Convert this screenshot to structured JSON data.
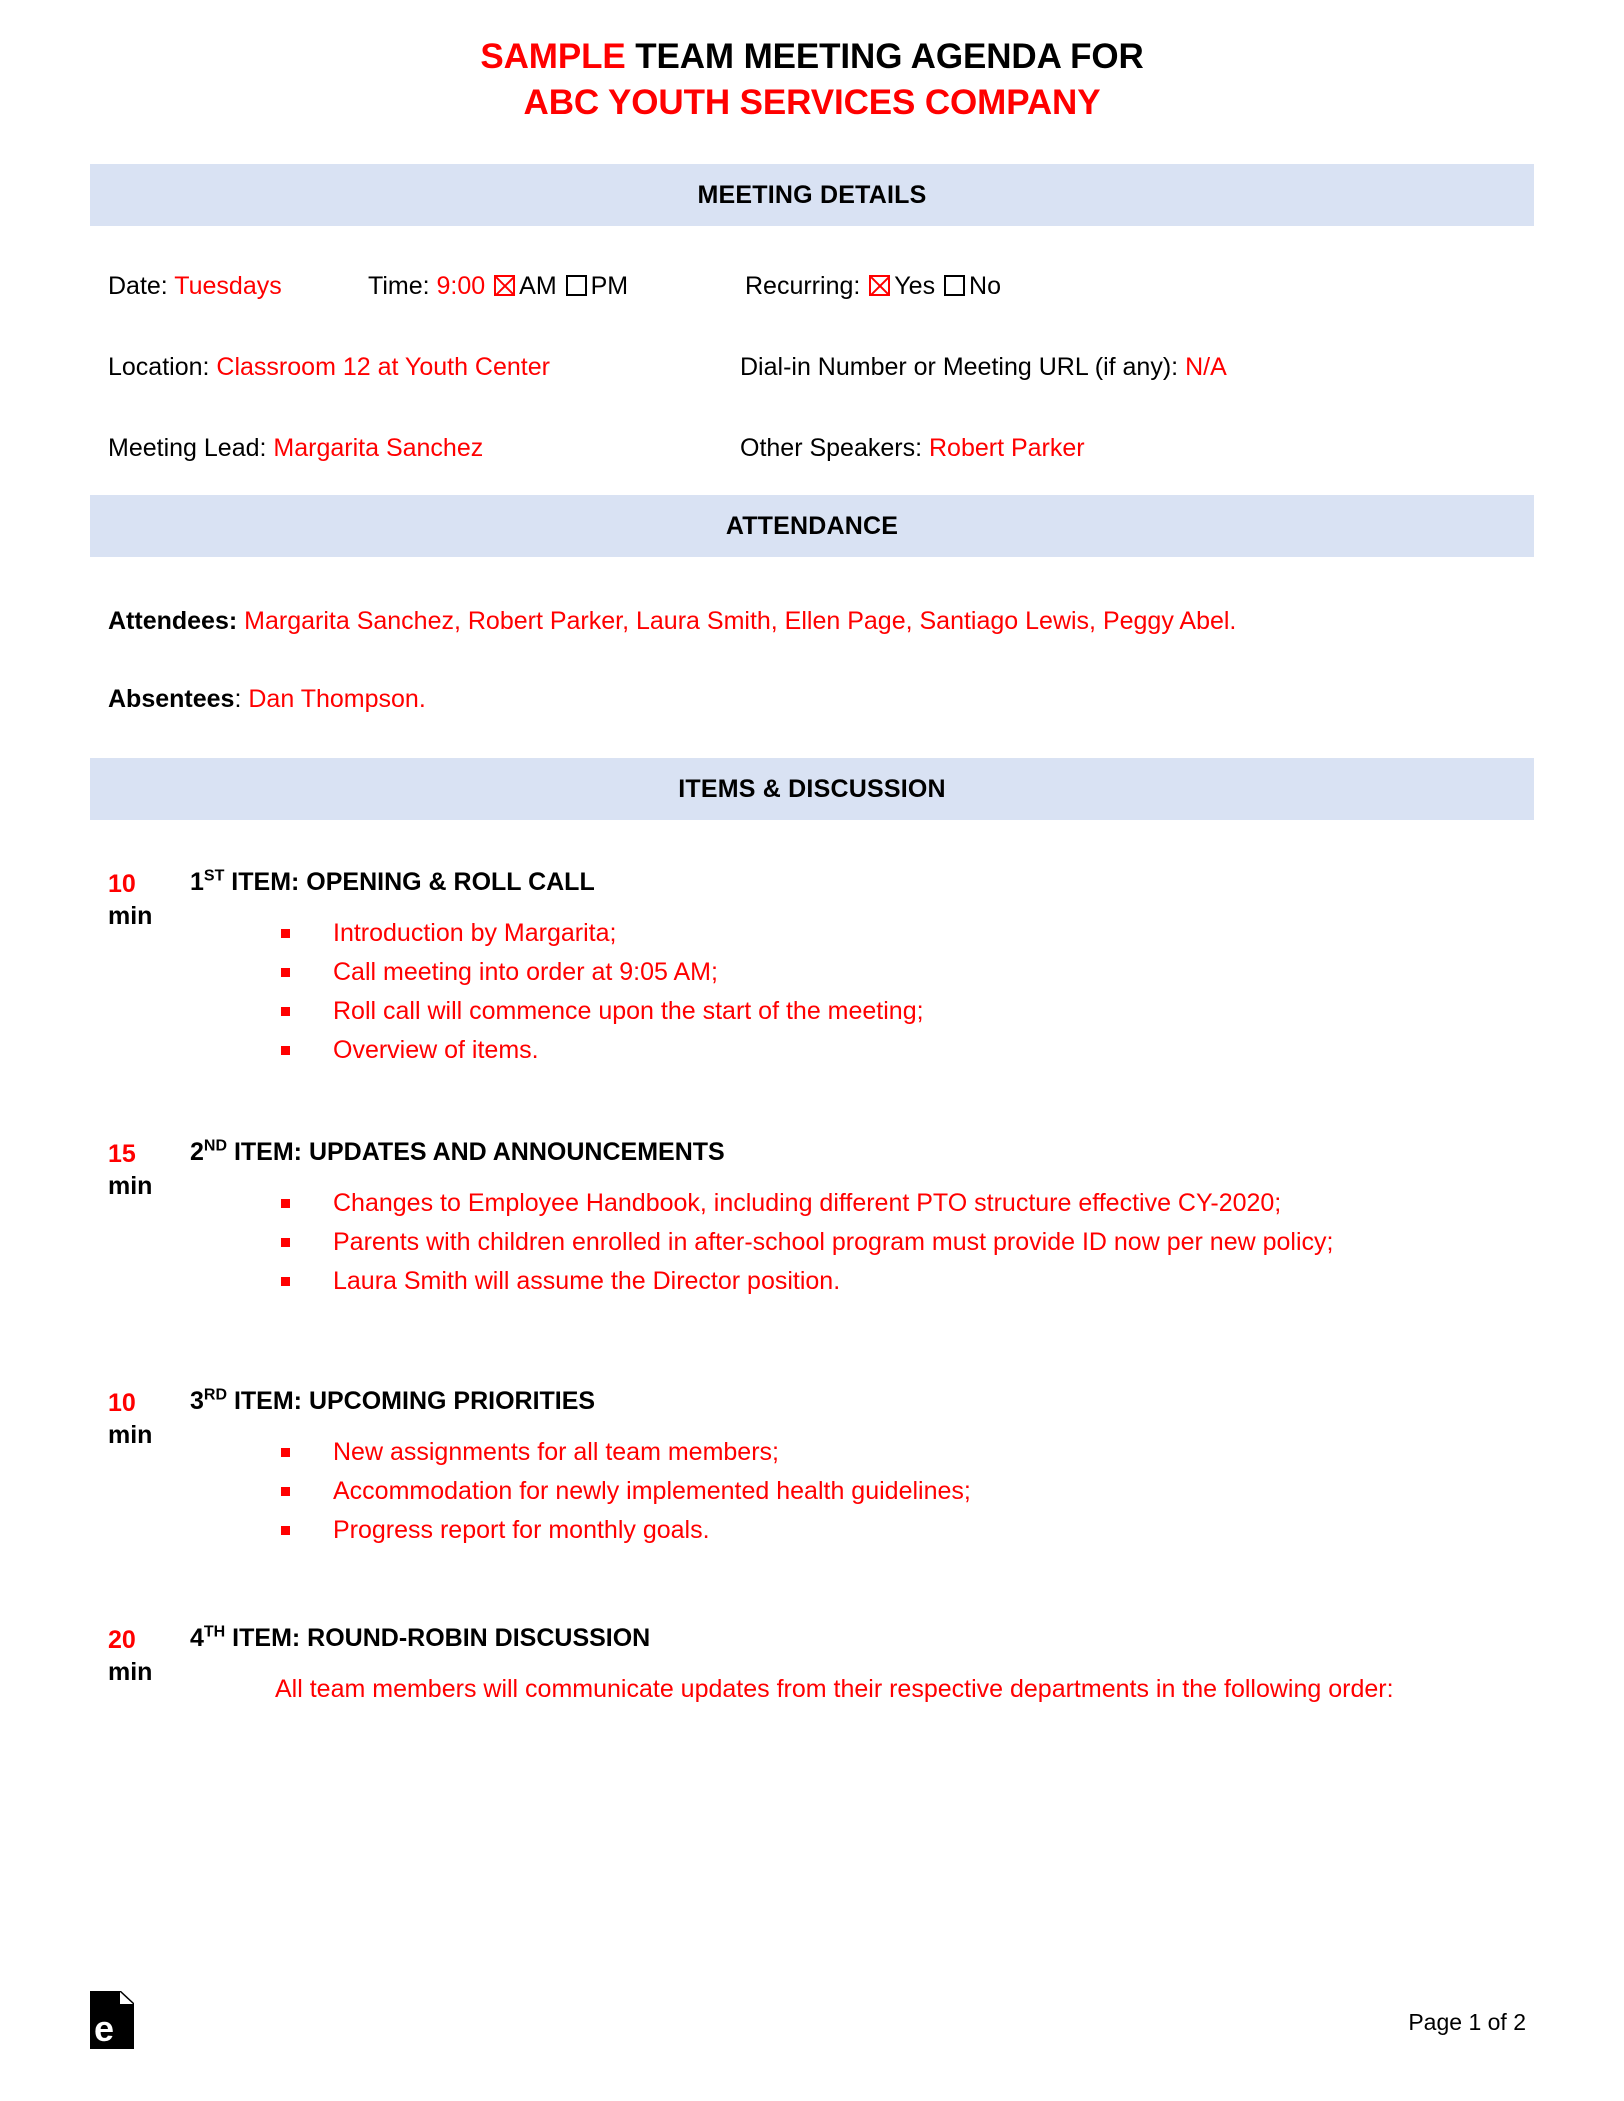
{
  "document": {
    "title_line1_highlight": "SAMPLE",
    "title_line1_rest": " TEAM MEETING AGENDA FOR",
    "title_line2": "ABC YOUTH SERVICES COMPANY",
    "accent_color": "#ff0000",
    "band_color": "#d9e2f3"
  },
  "sections": {
    "meeting_details_heading": "MEETING DETAILS",
    "attendance_heading": "ATTENDANCE",
    "items_heading": "ITEMS & DISCUSSION"
  },
  "meeting_details": {
    "date_label": "Date:",
    "date_value": "Tuesdays",
    "time_label": "Time:",
    "time_value": "9:00",
    "am_label": "AM",
    "pm_label": "PM",
    "am_checked": true,
    "pm_checked": false,
    "recurring_label": "Recurring:",
    "recurring_yes_label": "Yes",
    "recurring_no_label": "No",
    "recurring_yes_checked": true,
    "recurring_no_checked": false,
    "location_label": "Location:",
    "location_value": "Classroom 12 at Youth Center",
    "dialin_label": "Dial-in Number or Meeting URL (if any):",
    "dialin_value": "N/A",
    "lead_label": "Meeting Lead:",
    "lead_value": "Margarita Sanchez",
    "speakers_label": "Other Speakers:",
    "speakers_value": "Robert Parker"
  },
  "attendance": {
    "attendees_label": "Attendees",
    "attendees_colon": ":",
    "attendees_value": "Margarita Sanchez, Robert Parker, Laura Smith, Ellen Page, Santiago Lewis, Peggy Abel.",
    "absentees_label": "Absentees",
    "absentees_colon": ":",
    "absentees_value": "Dan Thompson."
  },
  "items": [
    {
      "minutes": "10",
      "unit": "min",
      "ordinal": "1",
      "ordinal_sup": "ST",
      "title_rest": " ITEM: OPENING & ROLL CALL",
      "bullets": [
        "Introduction by Margarita;",
        "Call meeting into order at 9:05 AM;",
        "Roll call will commence upon the start of the meeting;",
        "Overview of items."
      ],
      "paragraph": ""
    },
    {
      "minutes": "15",
      "unit": "min",
      "ordinal": "2",
      "ordinal_sup": "ND",
      "title_rest": " ITEM: UPDATES AND ANNOUNCEMENTS",
      "bullets": [
        "Changes to Employee Handbook, including different PTO structure effective CY-2020;",
        "Parents with children enrolled in after-school program must provide ID now per new policy;",
        "Laura Smith will assume the Director position."
      ],
      "paragraph": ""
    },
    {
      "minutes": "10",
      "unit": "min",
      "ordinal": "3",
      "ordinal_sup": "RD",
      "title_rest": " ITEM: UPCOMING PRIORITIES",
      "bullets": [
        "New assignments for all team members;",
        "Accommodation for newly implemented health guidelines;",
        "Progress report for monthly goals."
      ],
      "paragraph": ""
    },
    {
      "minutes": "20",
      "unit": "min",
      "ordinal": "4",
      "ordinal_sup": "TH",
      "title_rest": " ITEM: ROUND-ROBIN DISCUSSION",
      "bullets": [],
      "paragraph": "All team members will communicate updates from their respective departments in the following order:"
    }
  ],
  "footer": {
    "logo_letter": "e",
    "page_number": "Page 1 of 2"
  }
}
